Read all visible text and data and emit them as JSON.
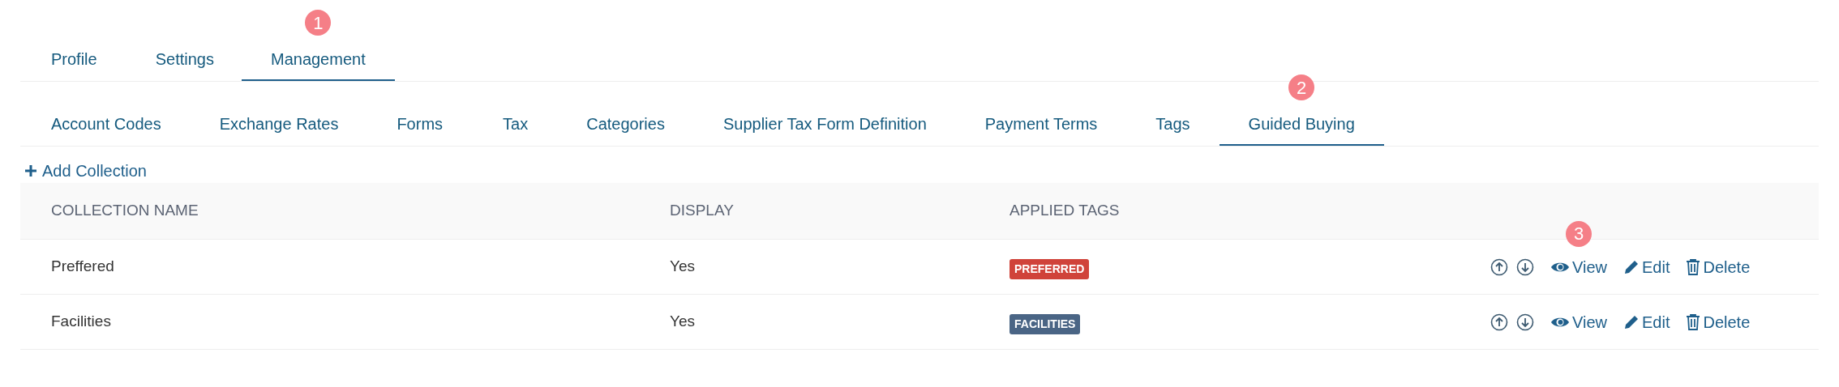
{
  "tabs": [
    {
      "label": "Profile",
      "selected": false
    },
    {
      "label": "Settings",
      "selected": false
    },
    {
      "label": "Management",
      "selected": true,
      "marker": "1"
    }
  ],
  "subtabs": [
    {
      "label": "Account Codes",
      "selected": false
    },
    {
      "label": "Exchange Rates",
      "selected": false
    },
    {
      "label": "Forms",
      "selected": false
    },
    {
      "label": "Tax",
      "selected": false
    },
    {
      "label": "Categories",
      "selected": false
    },
    {
      "label": "Supplier Tax Form Definition",
      "selected": false
    },
    {
      "label": "Payment Terms",
      "selected": false
    },
    {
      "label": "Tags",
      "selected": false
    },
    {
      "label": "Guided Buying",
      "selected": true,
      "marker": "2"
    }
  ],
  "add_button": "Add Collection",
  "table": {
    "columns": [
      "COLLECTION NAME",
      "DISPLAY",
      "APPLIED TAGS"
    ],
    "rows": [
      {
        "name": "Preffered",
        "display": "Yes",
        "tag": {
          "label": "PREFERRED",
          "color": "#d0433a"
        },
        "actions": {
          "view": "View",
          "edit": "Edit",
          "delete": "Delete"
        },
        "marker": "3"
      },
      {
        "name": "Facilities",
        "display": "Yes",
        "tag": {
          "label": "FACILITIES",
          "color": "#4a6585"
        },
        "actions": {
          "view": "View",
          "edit": "Edit",
          "delete": "Delete"
        }
      }
    ]
  }
}
